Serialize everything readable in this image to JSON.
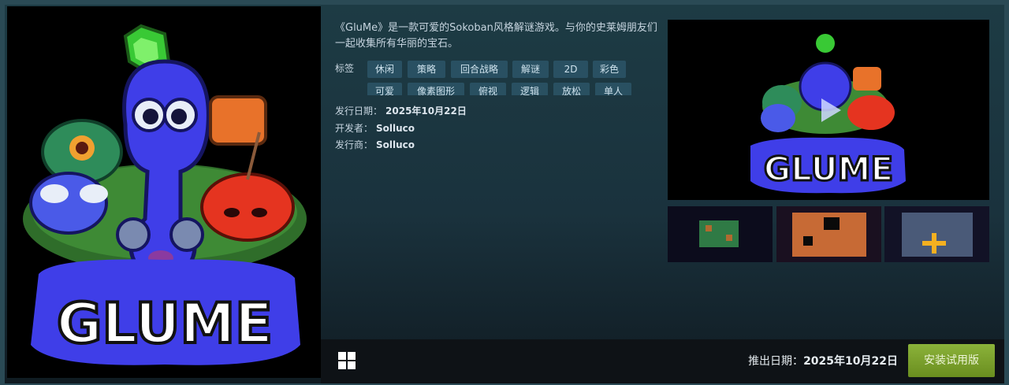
{
  "capsule": {
    "logo_text": "GLUME"
  },
  "description": "《GluMe》是一款可爱的Sokoban风格解谜游戏。与你的史莱姆朋友们一起收集所有华丽的宝石。",
  "tags": {
    "label": "标签",
    "items": [
      "休闲",
      "策略",
      "回合战略",
      "解谜",
      "2D",
      "彩色",
      "可爱",
      "像素图形",
      "俯视",
      "逻辑",
      "放松",
      "单人"
    ]
  },
  "info": {
    "release_label": "发行日期：",
    "release_value": "2025年10月22日",
    "developer_label": "开发者：",
    "developer_value": "Solluco",
    "publisher_label": "发行商：",
    "publisher_value": "Solluco"
  },
  "media": {
    "main_logo_text": "GLUME",
    "thumbnails": [
      "screenshot-1",
      "screenshot-2",
      "screenshot-3"
    ]
  },
  "bottom_bar": {
    "platform_icon": "windows-icon",
    "release_label": "推出日期：",
    "release_value": "2025年10月22日",
    "demo_button": "安装试用版"
  },
  "colors": {
    "demo_button": "#7ea02e",
    "tag_bg": "#2c4a59",
    "slime_blue": "#3f3ee8",
    "gem_green": "#3fd13a"
  }
}
